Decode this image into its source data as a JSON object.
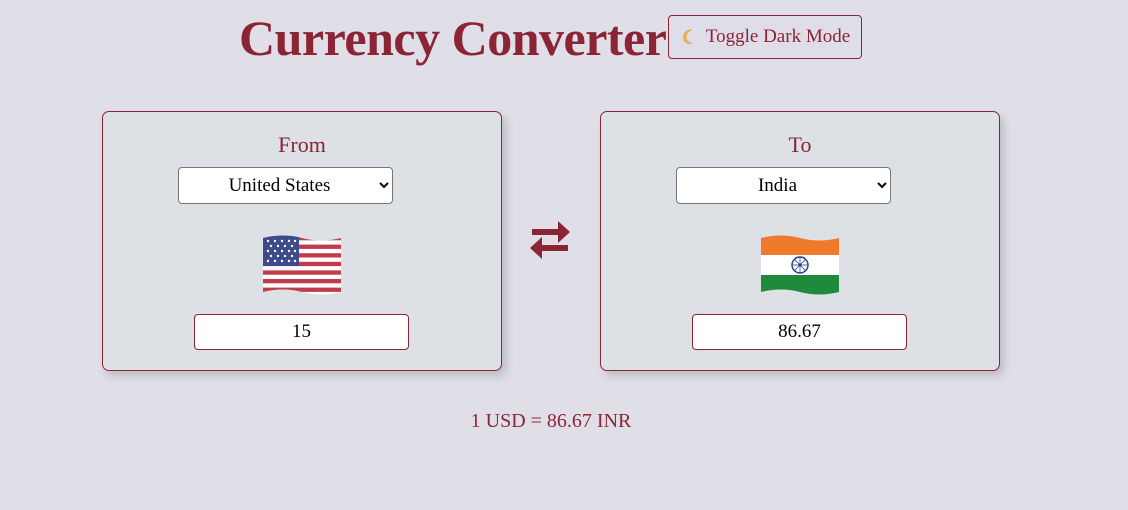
{
  "header": {
    "title": "Currency Converter",
    "dark_mode_label": "Toggle Dark Mode",
    "dark_mode_icon": "crescent-moon-icon"
  },
  "from_card": {
    "label": "From",
    "selected_country": "United States",
    "flag_icon": "us-flag-icon",
    "amount": "15"
  },
  "to_card": {
    "label": "To",
    "selected_country": "India",
    "flag_icon": "india-flag-icon",
    "amount": "86.67"
  },
  "swap": {
    "icon": "swap-arrows-icon"
  },
  "rate": {
    "text": "1 USD = 86.67 INR"
  },
  "colors": {
    "accent": "#8b2435",
    "background": "#e0dfe8",
    "card_background": "#dde0e4"
  }
}
